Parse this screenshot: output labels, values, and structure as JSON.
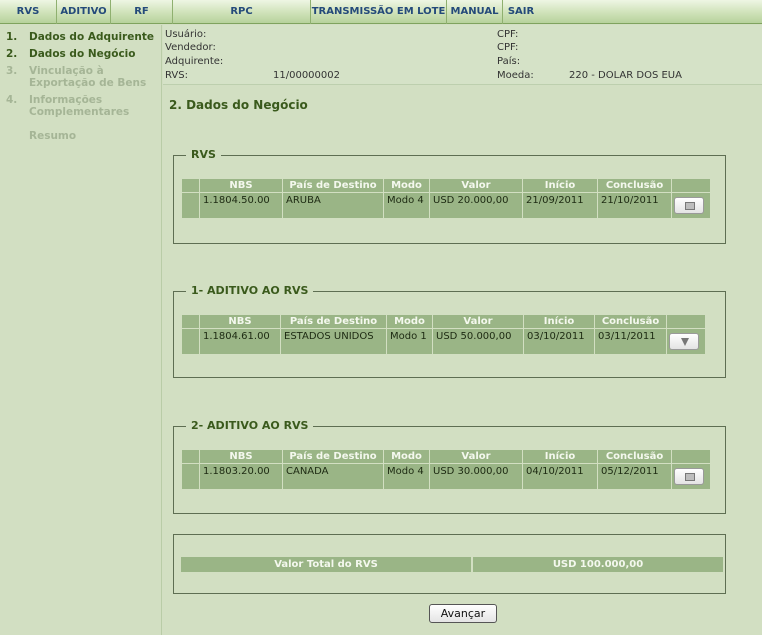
{
  "menu": [
    {
      "label": "RVS",
      "name": "menu-rvs"
    },
    {
      "label": "ADITIVO",
      "name": "menu-aditivo"
    },
    {
      "label": "RF",
      "name": "menu-rf"
    },
    {
      "label": "RPC",
      "name": "menu-rpc"
    },
    {
      "label": "TRANSMISSÃO EM LOTE",
      "name": "menu-transmissao-em-lote"
    },
    {
      "label": "MANUAL",
      "name": "menu-manual"
    },
    {
      "label": "SAIR",
      "name": "menu-sair"
    }
  ],
  "sidebar": {
    "steps": [
      {
        "num": "1.",
        "label": "Dados do Adquirente"
      },
      {
        "num": "2.",
        "label": "Dados do Negócio"
      },
      {
        "num": "3.",
        "label": "Vinculação à Exportação de Bens"
      },
      {
        "num": "4.",
        "label": "Informações Complementares"
      },
      {
        "num": "",
        "label": "Resumo"
      }
    ]
  },
  "info": {
    "usuario_label": "Usuário:",
    "vendedor_label": "Vendedor:",
    "adquirente_label": "Adquirente:",
    "rvs_label": "RVS:",
    "rvs_value": "11/00000002",
    "cpf1_label": "CPF:",
    "cpf2_label": "CPF:",
    "pais_label": "País:",
    "moeda_label": "Moeda:",
    "moeda_value": "220 - DOLAR DOS EUA"
  },
  "page_title": "2. Dados do Negócio",
  "columns": [
    "NBS",
    "País de Destino",
    "Modo",
    "Valor",
    "Início",
    "Conclusão"
  ],
  "sections": [
    {
      "legend": "RVS",
      "row": [
        "1.1804.50.00",
        "ARUBA",
        "Modo 4",
        "USD 20.000,00",
        "21/09/2011",
        "21/10/2011"
      ],
      "icon": "document-icon"
    },
    {
      "legend": "1- ADITIVO AO RVS",
      "row": [
        "1.1804.61.00",
        "ESTADOS UNIDOS",
        "Modo 1",
        "USD 50.000,00",
        "03/10/2011",
        "03/11/2011"
      ],
      "icon": "arrow-down-icon"
    },
    {
      "legend": "2- ADITIVO AO RVS",
      "row": [
        "1.1803.20.00",
        "CANADA",
        "Modo 4",
        "USD 30.000,00",
        "04/10/2011",
        "05/12/2011"
      ],
      "icon": "document-icon"
    }
  ],
  "total": {
    "label": "Valor Total do RVS",
    "value": "USD 100.000,00"
  },
  "buttons": {
    "avancar": "Avançar"
  }
}
